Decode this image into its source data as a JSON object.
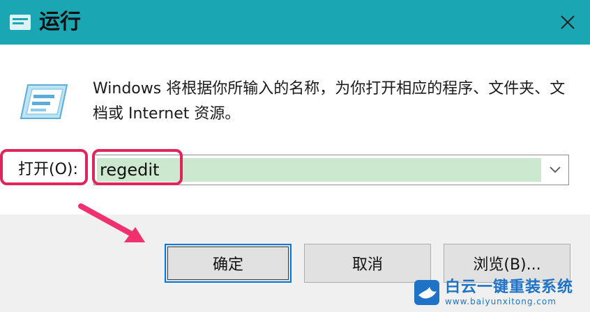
{
  "window": {
    "title": "运行",
    "close_icon": "close-icon"
  },
  "body": {
    "description": "Windows 将根据你所输入的名称，为你打开相应的程序、文件夹、文档或 Internet 资源。",
    "run_icon": "run-icon"
  },
  "open": {
    "label": "打开(O):",
    "value": "regedit"
  },
  "buttons": {
    "ok": "确定",
    "cancel": "取消",
    "browse": "浏览(B)..."
  },
  "annotation": {
    "highlight_color": "#e1245c",
    "arrow_color": "#f0306f"
  },
  "watermark": {
    "name": "白云一键重装系统",
    "url": "www.baiyunxitong.com"
  },
  "colors": {
    "titlebar": "#1ba6b4",
    "selection": "#cce8cf",
    "primary_border": "#0078d7",
    "watermark": "#1f73c7"
  }
}
